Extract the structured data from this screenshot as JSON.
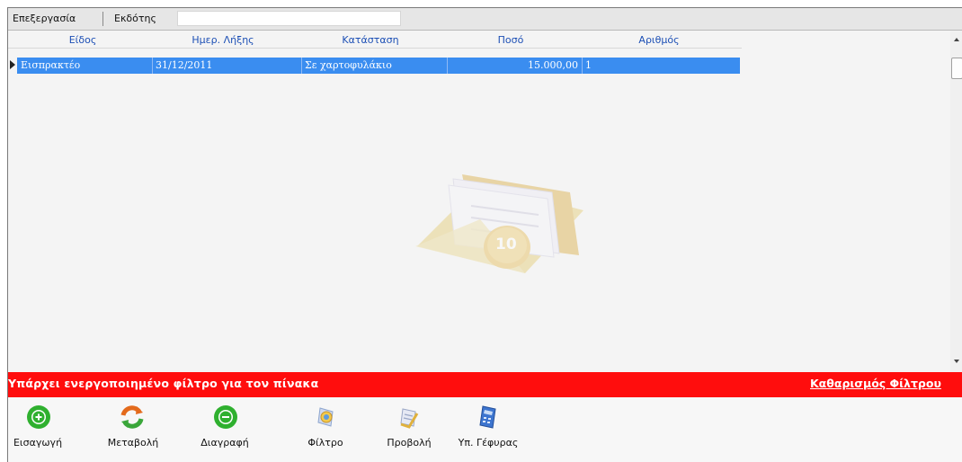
{
  "tabs": [
    "Επεξεργασία",
    "Εκδότης"
  ],
  "grid": {
    "columns": [
      "Είδος",
      "Ημερ. Λήξης",
      "Κατάσταση",
      "Ποσό",
      "Αριθμός"
    ],
    "rows": [
      {
        "type": "Εισπρακτέο",
        "due_date": "31/12/2011",
        "status": "Σε χαρτοφυλάκιο",
        "amount": "15.000,00",
        "number": "1"
      }
    ]
  },
  "watermark": {
    "coin_text": "10"
  },
  "filter_bar": {
    "message": "Υπάρχει ενεργοποιημένο φίλτρο για τον πίνακα",
    "clear_link": "Καθαρισμός Φίλτρου",
    "color": "#ff0d0d"
  },
  "toolbar": {
    "buttons": [
      {
        "label": "Εισαγωγή",
        "icon": "plus-circle-icon"
      },
      {
        "label": "Μεταβολή",
        "icon": "refresh-icon"
      },
      {
        "label": "Διαγραφή",
        "icon": "minus-circle-icon"
      },
      {
        "label": "Φίλτρο",
        "icon": "filter-icon"
      },
      {
        "label": "Προβολή",
        "icon": "view-document-icon"
      },
      {
        "label": "Υπ. Γέφυρας",
        "icon": "calculator-icon"
      }
    ]
  },
  "colors": {
    "selection": "#3a8df0",
    "header_text": "#1c4fb5",
    "accent_green": "#2fb02f"
  }
}
